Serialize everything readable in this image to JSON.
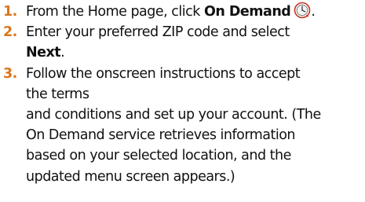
{
  "steps": [
    {
      "number": "1.",
      "line1_before": "From the Home page, click ",
      "line1_bold": "On Demand",
      "icon": "on-demand-clock-icon"
    },
    {
      "number": "2.",
      "line1": "Enter your preferred ZIP code and select",
      "line2_bold": "Next",
      "line2_after": "."
    },
    {
      "number": "3.",
      "lines": [
        "Follow the onscreen instructions to accept",
        "the terms",
        "and conditions and set up your account. (The",
        "On Demand service retrieves information",
        "based on your selected location, and the",
        "updated menu screen appears.)"
      ]
    }
  ],
  "colors": {
    "number": "#d9771c",
    "text": "#111111",
    "icon_ring": "#c8311f"
  }
}
